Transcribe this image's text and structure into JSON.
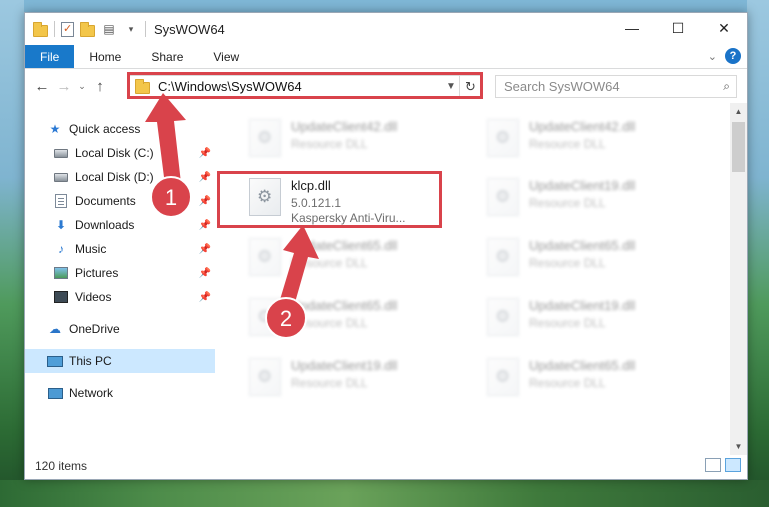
{
  "window": {
    "title": "SysWOW64"
  },
  "window_controls": {
    "minimize": "—",
    "maximize": "☐",
    "close": "✕"
  },
  "ribbon": {
    "tabs": [
      "File",
      "Home",
      "Share",
      "View"
    ],
    "help": "?"
  },
  "nav_buttons": {
    "back": "←",
    "forward": "→",
    "recent": "⌄",
    "up": "↑"
  },
  "address": {
    "path": "C:\\Windows\\SysWOW64"
  },
  "search": {
    "placeholder": "Search SysWOW64"
  },
  "sidebar": {
    "items": [
      {
        "label": "Quick access",
        "icon": "star-icon"
      },
      {
        "label": "Local Disk (C:)",
        "icon": "drive-icon",
        "pinned": true
      },
      {
        "label": "Local Disk (D:)",
        "icon": "drive-icon",
        "pinned": true
      },
      {
        "label": "Documents",
        "icon": "documents-icon",
        "pinned": true
      },
      {
        "label": "Downloads",
        "icon": "downloads-icon",
        "pinned": true
      },
      {
        "label": "Music",
        "icon": "music-icon",
        "pinned": true
      },
      {
        "label": "Pictures",
        "icon": "pictures-icon",
        "pinned": true
      },
      {
        "label": "Videos",
        "icon": "videos-icon",
        "pinned": true
      },
      {
        "label": "OneDrive",
        "icon": "onedrive-icon"
      },
      {
        "label": "This PC",
        "icon": "this-pc-icon",
        "selected": true
      },
      {
        "label": "Network",
        "icon": "network-icon"
      }
    ]
  },
  "files": {
    "highlighted": {
      "name": "klcp.dll",
      "version": "5.0.121.1",
      "description": "Kaspersky Anti-Viru..."
    },
    "blurred": [
      {
        "name": "UpdateClient42.dll",
        "description": "Resource DLL"
      },
      {
        "name": "UpdateClient42.dll",
        "description": "Resource DLL"
      },
      {
        "name": "UpdateClient19.dll",
        "description": "Resource DLL"
      },
      {
        "name": "UpdateClient65.dll",
        "description": "Resource DLL"
      },
      {
        "name": "UpdateClient65.dll",
        "description": "Resource DLL"
      },
      {
        "name": "UpdateClient65.dll",
        "description": "Resource DLL"
      },
      {
        "name": "UpdateClient19.dll",
        "description": "Resource DLL"
      },
      {
        "name": "UpdateClient19.dll",
        "description": "Resource DLL"
      },
      {
        "name": "UpdateClient65.dll",
        "description": "Resource DLL"
      }
    ]
  },
  "status": {
    "item_count": "120 items"
  },
  "annotations": {
    "step1": "1",
    "step2": "2",
    "color": "#d9434b"
  }
}
